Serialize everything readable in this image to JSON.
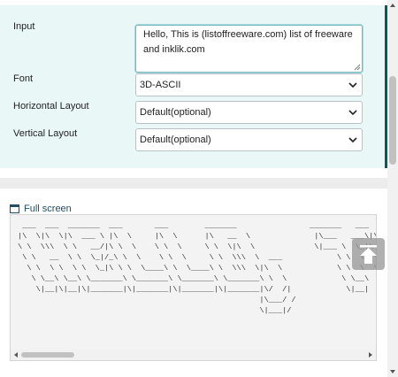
{
  "form": {
    "input_label": "Input",
    "input_value": "Hello, This is (listoffreeware.com) list of freeware and inklik.com",
    "font_label": "Font",
    "font_value": "3D-ASCII",
    "horizontal_label": "Horizontal Layout",
    "horizontal_value": "Default(optional)",
    "vertical_label": "Vertical Layout",
    "vertical_value": "Default(optional)"
  },
  "output": {
    "fullscreen_label": "Full screen",
    "ascii_art": " ___  ___  _______  ___       ___        _______                _______   ___\n|\\  \\|\\  \\|\\  ___ \\ |\\  \\     |\\  \\      |\\   __  \\              |\\___   ___\\|\\  \\\n\\ \\  \\\\\\  \\ \\   __/|\\ \\  \\    \\ \\  \\     \\ \\  \\|\\  \\             \\|___ \\  \\_|\\ \\  \\\n \\ \\   __  \\ \\  \\_|/_\\ \\  \\    \\ \\  \\     \\ \\  \\\\\\  \\  ___            \\ \\  \\  \\ \\   \n  \\ \\  \\ \\  \\ \\  \\_|\\ \\ \\  \\____\\ \\  \\____\\ \\  \\\\\\  \\|\\  \\            \\ \\  \\  \\ \\  \n   \\ \\__\\ \\__\\ \\_______\\ \\_______\\ \\_______\\ \\_______\\ \\  \\            \\ \\__\\  \\ \\_\n    \\|__|\\|__|\\|_______|\\|_______|\\|_______|\\|_______|\\/  /|            \\|__|   \\|__\n                                                     |\\___/ /\n                                                     \\|___|/"
  },
  "colors": {
    "panel_bg": "#eaf7f7",
    "accent": "#0b5a5a",
    "link": "#1f4e66"
  },
  "icons": {
    "fullscreen": "window-icon",
    "back_to_top": "arrow-up-icon",
    "dropdown": "chevron-down-icon"
  }
}
